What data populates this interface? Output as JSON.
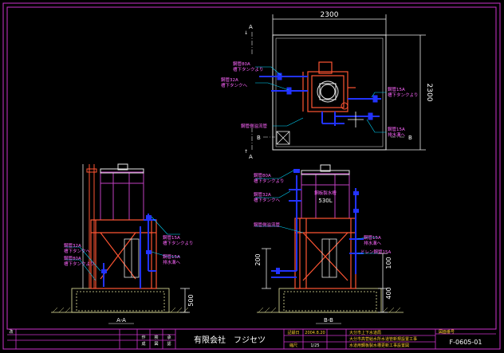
{
  "colors": {
    "background": "#000000",
    "frame": "#cc33cc",
    "structure": "#ff5533",
    "pipe": "#2233ff",
    "equipment": "#ffffff",
    "dimension": "#e8e8e8",
    "leader": "#00d8ff",
    "label": "#ff66ff",
    "tank": "#c040c0",
    "ground": "#e8e8a0"
  },
  "plan_view": {
    "width_dim": "2300",
    "height_dim": "2300",
    "section_a": "A",
    "section_b": "B",
    "arrow_mark": "↓",
    "arrow_mark_right": "↑",
    "labels": {
      "pipe_left_top": "鋼管80A",
      "pipe_left_top_sub": "槽下タンクより",
      "pipe_left_mid": "鋼管32A",
      "pipe_left_mid_sub": "槽下タンクへ",
      "pipe_right_top": "鋼管15A",
      "pipe_right_top_sub": "槽下タンクより",
      "pipe_right_bottom": "鋼管15A",
      "pipe_right_bottom_sub": "排水溝へ",
      "overflow": "鋼管側溢流管"
    }
  },
  "section_aa": {
    "title": "A-A",
    "dim_500": "500",
    "labels": {
      "pipe_right_top": "鋼管15A",
      "pipe_right_top_sub": "槽下タンクより",
      "pipe_right_mid": "鋼管15A",
      "pipe_right_mid_sub": "排水溝へ",
      "pipe_left_top": "鋼管32A",
      "pipe_left_top_sub": "槽下タンクへ",
      "pipe_left_bottom": "鋼管80A",
      "pipe_left_bottom_sub": "槽下タンクより"
    }
  },
  "section_bb": {
    "title": "B-B",
    "dim_200": "200",
    "dim_100": "100",
    "dim_400": "400",
    "tank_label": "鋼板製水槽",
    "tank_capacity": "530L",
    "labels": {
      "pipe_left_top": "鋼管80A",
      "pipe_left_top_sub": "槽下タンクより",
      "pipe_left_mid": "鋼管32A",
      "pipe_left_mid_sub": "槽下タンクへ",
      "overflow": "鋼管側溢流管",
      "pipe_right_top": "鋼管15A",
      "pipe_right_top_sub": "排水溝へ",
      "drain": "ドレン鋼管15A"
    }
  },
  "title_block": {
    "company": "有限会社　フジセツ",
    "rev_col": "改",
    "cells": [
      "作",
      "成",
      "検",
      "図",
      "承",
      "認"
    ],
    "date_label": "記録日",
    "date_value": "2004.8.20",
    "scale_label": "縮尺",
    "scale_value": "1/25",
    "owner": "大分市上下水道局",
    "project_1": "大分市高菅給水所水道管新規設置工事",
    "project_2": "水道用鋼板製水槽更新工事設置図",
    "drawing_no_label": "図面番号",
    "drawing_no": "F-0605-01"
  }
}
